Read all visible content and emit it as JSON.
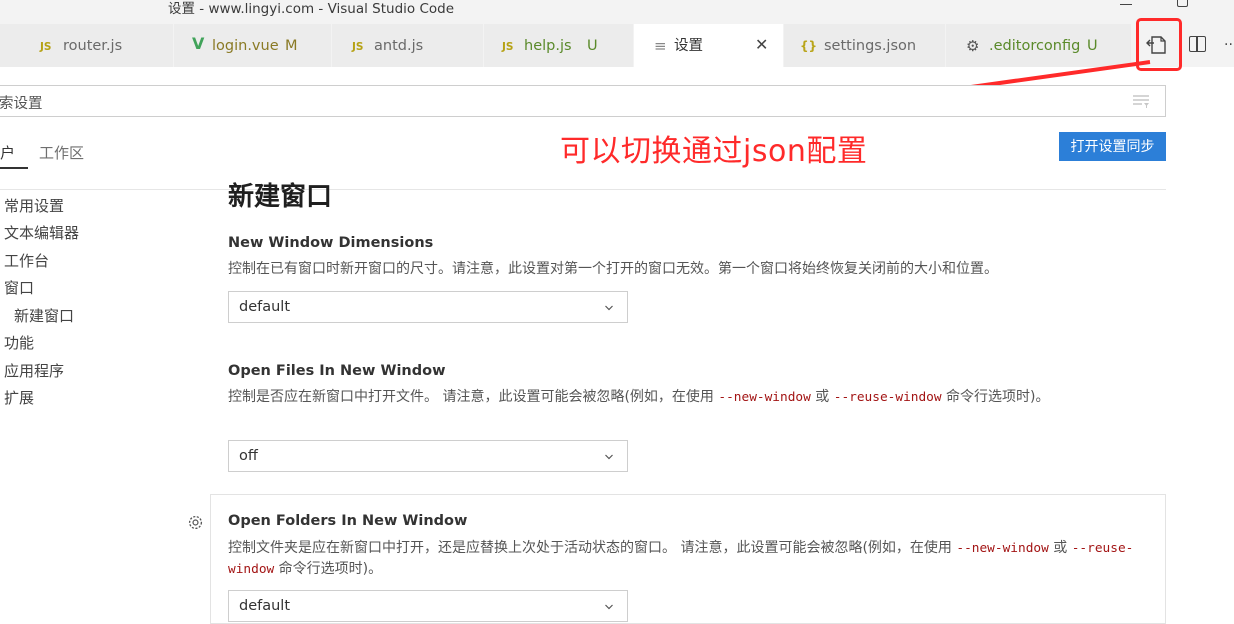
{
  "window": {
    "title": "设置 - www.lingyi.com - Visual Studio Code"
  },
  "tabs": [
    {
      "icon": "js-icon",
      "label": "router.js",
      "status": ""
    },
    {
      "icon": "vue-icon",
      "label": "login.vue",
      "status": "M"
    },
    {
      "icon": "js-icon",
      "label": "antd.js",
      "status": ""
    },
    {
      "icon": "js-icon",
      "label": "help.js",
      "status": "U"
    },
    {
      "icon": "settings-file-icon",
      "label": "设置",
      "close": "✕"
    },
    {
      "icon": "json-icon",
      "label": "settings.json",
      "status": ""
    },
    {
      "icon": "gear-icon",
      "label": ".editorconfig",
      "status": "U"
    }
  ],
  "search": {
    "value": "索设置"
  },
  "scope_tabs": [
    "户",
    "工作区"
  ],
  "sync_button": "打开设置同步",
  "annotation": "可以切换通过json配置",
  "toc": [
    "常用设置",
    "文本编辑器",
    "工作台",
    "窗口",
    "新建窗口",
    "功能",
    "应用程序",
    "扩展"
  ],
  "section": {
    "heading": "新建窗口"
  },
  "settings": [
    {
      "title": "New Window Dimensions",
      "desc": "控制在已有窗口时新开窗口的尺寸。请注意，此设置对第一个打开的窗口无效。第一个窗口将始终恢复关闭前的大小和位置。",
      "value": "default"
    },
    {
      "title": "Open Files In New Window",
      "desc_1": "控制是否应在新窗口中打开文件。 请注意，此设置可能会被忽略(例如，在使用 ",
      "code_1": "--new-window",
      "desc_2": " 或 ",
      "code_2": "--reuse-window",
      "desc_3": " 命令行选项时)。",
      "value": "off"
    },
    {
      "title": "Open Folders In New Window",
      "desc_1": "控制文件夹是应在新窗口中打开，还是应替换上次处于活动状态的窗口。 请注意，此设置可能会被忽略(例如，在使用 ",
      "code_1": "--new-window",
      "desc_2": " 或 ",
      "code_2": "--reuse-window",
      "desc_3": " 命令行选项时)。",
      "value": "default"
    }
  ],
  "colors": {
    "accent": "#2c7fd8",
    "annotation": "#ff2a2a"
  }
}
